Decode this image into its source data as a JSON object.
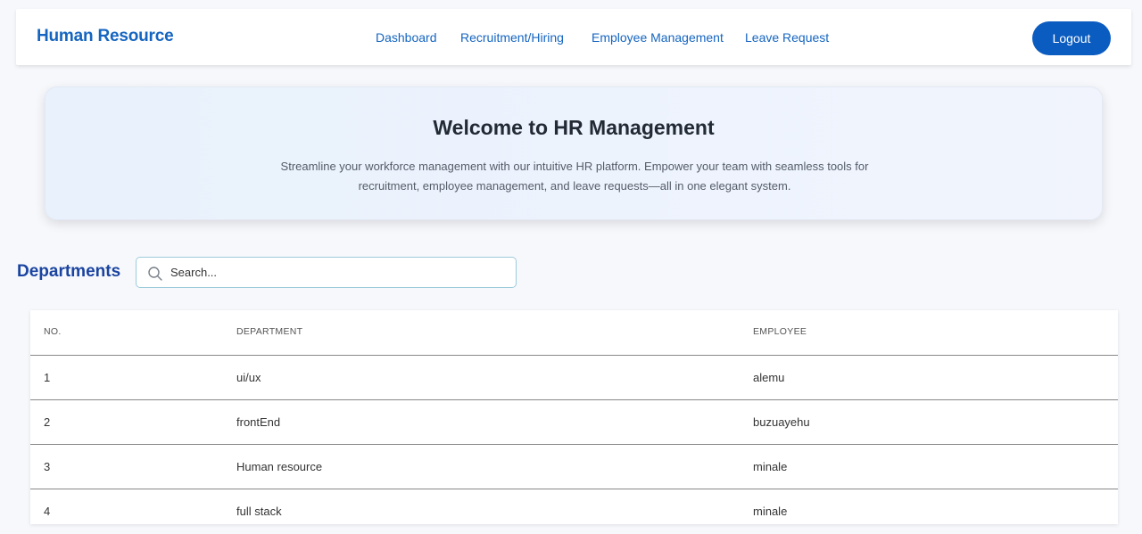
{
  "navbar": {
    "brand": "Human Resource",
    "links": [
      "Dashboard",
      "Recruitment/Hiring",
      "Employee Management",
      "Leave Request"
    ],
    "logout_label": "Logout"
  },
  "hero": {
    "title": "Welcome to HR Management",
    "text": "Streamline your workforce management with our intuitive HR platform. Empower your team with seamless tools for recruitment, employee management, and leave requests—all in one elegant system."
  },
  "departments": {
    "title": "Departments",
    "search_placeholder": "Search...",
    "columns": [
      "NO.",
      "DEPARTMENT",
      "EMPLOYEE"
    ],
    "rows": [
      {
        "no": "1",
        "department": "ui/ux",
        "employee": "alemu"
      },
      {
        "no": "2",
        "department": "frontEnd",
        "employee": "buzuayehu"
      },
      {
        "no": "3",
        "department": "Human resource",
        "employee": "minale"
      },
      {
        "no": "4",
        "department": "full stack",
        "employee": "minale"
      }
    ]
  },
  "colors": {
    "brand": "#1565c0",
    "logout_bg": "#0b5cc0",
    "departments_title": "#1a44a0"
  }
}
